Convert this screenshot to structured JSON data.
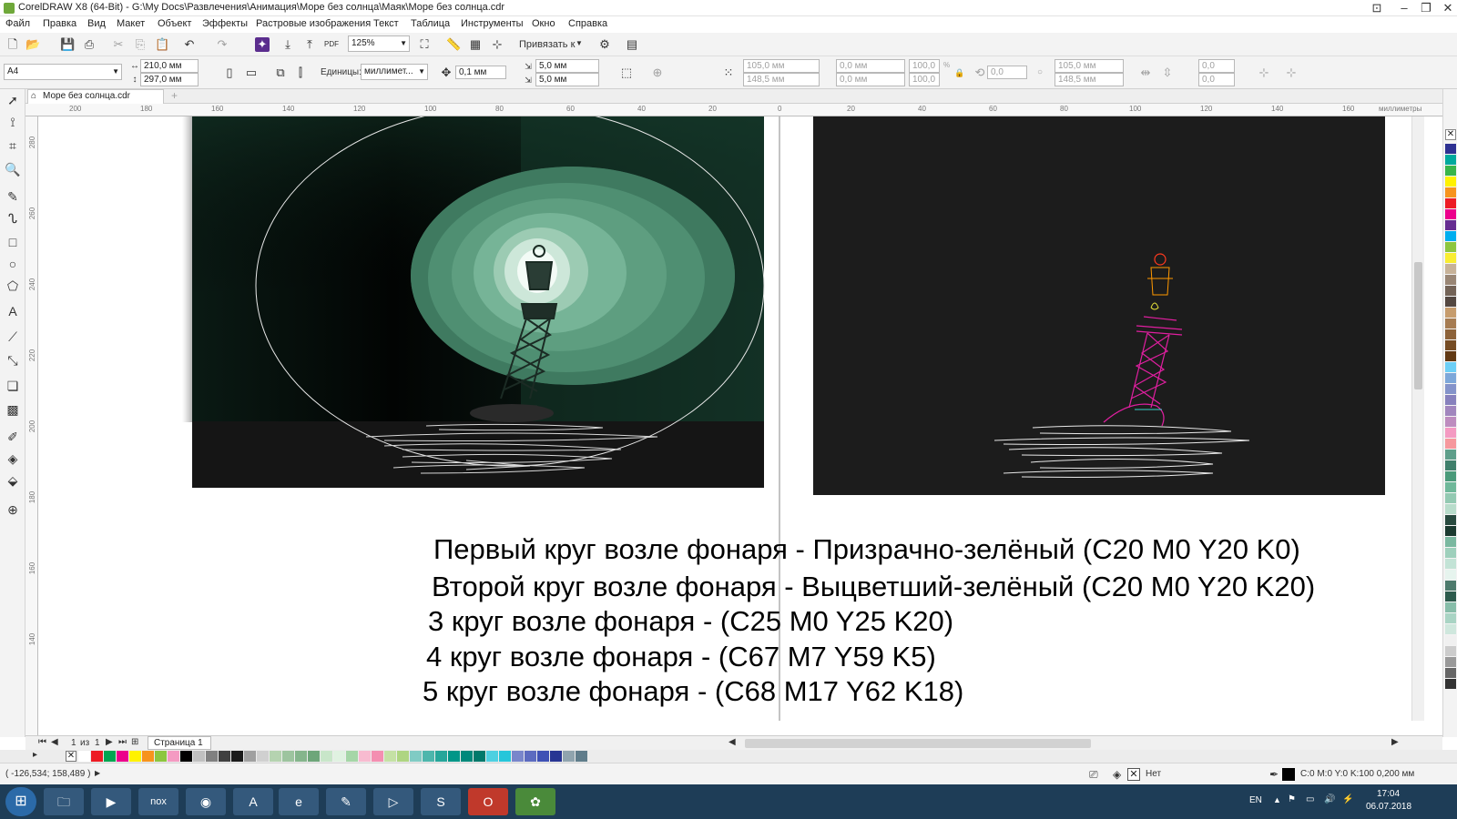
{
  "window": {
    "title": "CorelDRAW X8 (64-Bit) - G:\\My Docs\\Развлечения\\Анимация\\Море без солнца\\Маяк\\Море без солнца.cdr"
  },
  "menu": [
    "Файл",
    "Правка",
    "Вид",
    "Макет",
    "Объект",
    "Эффекты",
    "Растровые изображения",
    "Текст",
    "Таблица",
    "Инструменты",
    "Окно",
    "Справка"
  ],
  "toolbar": {
    "zoom": "125%",
    "snap_label": "Привязать к"
  },
  "property_bar": {
    "page_size": "A4",
    "width": "210,0 мм",
    "height": "297,0 мм",
    "units_label": "Единицы:",
    "units_value": "миллимет...",
    "nudge": "0,1 мм",
    "dup_x": "5,0 мм",
    "dup_y": "5,0 мм",
    "pos_x": "105,0 мм",
    "pos_y": "148,5 мм",
    "size_w": "0,0 мм",
    "size_h": "0,0 мм",
    "scale_w": "100,0",
    "scale_h": "100,0",
    "pct": "%",
    "angle": "0,0",
    "center_x": "105,0 мм",
    "center_y": "148,5 мм",
    "skew_h": "0,0",
    "skew_v": "0,0"
  },
  "document_tab": "Море без солнца.cdr",
  "ruler": {
    "units": "миллиметры",
    "h_ticks": [
      "200",
      "180",
      "160",
      "140",
      "120",
      "100",
      "80",
      "60",
      "40",
      "20",
      "0",
      "20",
      "40",
      "60",
      "80",
      "100",
      "120",
      "140",
      "160"
    ],
    "v_ticks": [
      "280",
      "260",
      "240",
      "220",
      "200",
      "180",
      "160",
      "140"
    ]
  },
  "notes": [
    "Первый круг возле фонаря - Призрачно-зелёный (C20 M0 Y20 K0)",
    "Второй круг возле фонаря - Выцветший-зелёный (C20 M0 Y20 K20)",
    "3 круг возле фонаря -  (C25 M0 Y25 K20)",
    "4 круг возле фонаря -  (C67 M7 Y59 K5)",
    "5 круг возле фонаря -  (C68 M17 Y62 K18)"
  ],
  "page_nav": {
    "counter_a": "1",
    "counter_of": "из",
    "counter_b": "1",
    "page_name": "Страница 1"
  },
  "status": {
    "coords": "( -126,534; 158,489 )",
    "fill_none": "Нет",
    "outline": "C:0 M:0 Y:0 K:100  0,200 мм"
  },
  "taskbar": {
    "lang": "EN",
    "time": "17:04",
    "date": "06.07.2018"
  },
  "palette_colors": [
    "#2e3192",
    "#00a99d",
    "#39b54a",
    "#fff200",
    "#f7941d",
    "#ed1c24",
    "#ec008c",
    "#662d91",
    "#00aeef",
    "#8dc63f",
    "#f9ed32",
    "#c7b299",
    "#998675",
    "#736357",
    "#534741",
    "#c69c6d",
    "#a67c52",
    "#8c6239",
    "#754c24",
    "#603813",
    "#6dcff6",
    "#7da7d9",
    "#8493ca",
    "#8781bd",
    "#a186be",
    "#bd8cbf",
    "#f49ac2",
    "#f6989d",
    "#5e9e8a",
    "#3f7f6b",
    "#4a9a7a",
    "#6fb89a",
    "#93c9b2",
    "#b8dccb",
    "#284a3f",
    "#1b3a30",
    "#7ab8a0",
    "#9ed0bc",
    "#c3e3d6",
    "#e6f4ee",
    "#4d7a6c",
    "#2c5a4c",
    "#87bda9",
    "#a9d4c4",
    "#cfe7dd",
    "#f0f0f0",
    "#cccccc",
    "#999999",
    "#666666",
    "#333333"
  ],
  "bottom_palette": [
    "#ffffff",
    "#ed1c24",
    "#00a651",
    "#ec008c",
    "#fff200",
    "#f7941d",
    "#8dc63f",
    "#f49ac2",
    "#000000",
    "#c0c0c0",
    "#808080",
    "#404040",
    "#1a1a1a",
    "#a0a0a0",
    "#d0d0d0",
    "#b5d3b0",
    "#9dc49f",
    "#85b58c",
    "#6ea67a",
    "#c8e6c9",
    "#e0f2e1",
    "#a5d6a7",
    "#f8bbd0",
    "#f48fb1",
    "#c5e1a5",
    "#aed581",
    "#80cbc4",
    "#4db6ac",
    "#26a69a",
    "#009688",
    "#00897b",
    "#00796b",
    "#4dd0e1",
    "#26c6da",
    "#7986cb",
    "#5c6bc0",
    "#3f51b5",
    "#283593",
    "#90a4ae",
    "#607d8b"
  ]
}
